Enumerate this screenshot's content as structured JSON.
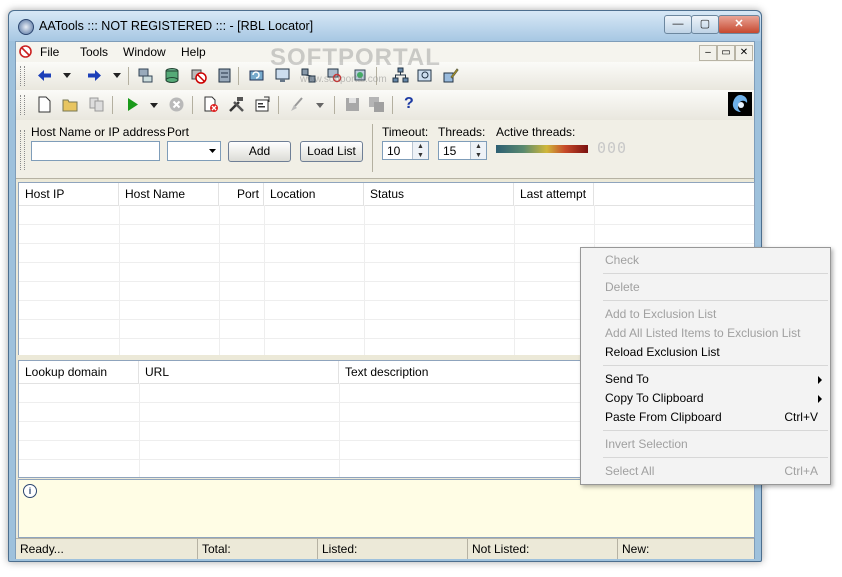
{
  "window": {
    "title": "AATools ::: NOT REGISTERED ::: - [RBL Locator]",
    "minimize": "0",
    "maximize": "1",
    "close": "r"
  },
  "menubar": {
    "items": [
      "File",
      "Tools",
      "Window",
      "Help"
    ],
    "mdi_minimize": "–",
    "mdi_restore": "▭",
    "mdi_close": "✕"
  },
  "toolbar1": {
    "icons": [
      "back-arrow-icon",
      "dropdown-arrow-icon",
      "forward-arrow-icon",
      "dropdown-arrow-icon",
      "network-computer-icon",
      "database-icon",
      "block-icon",
      "server-icon",
      "refresh-network-icon",
      "monitor-icon",
      "network-tools-icon",
      "lookup-icon",
      "hierarchy-icon",
      "map-icon",
      "pencil-icon"
    ]
  },
  "toolbar2": {
    "icons": [
      "new-file-icon",
      "open-folder-icon",
      "copy-icon",
      "play-icon",
      "dropdown-arrow-icon",
      "stop-icon",
      "delete-file-icon",
      "tools-icon",
      "properties-icon",
      "brush-icon",
      "dropdown-arrow-icon",
      "save-icon",
      "save-all-icon",
      "help-icon"
    ],
    "help_glyph": "?"
  },
  "form": {
    "host_label": "Host Name or IP address",
    "host_value": "",
    "port_label": "Port",
    "port_value": "",
    "add_label": "Add",
    "load_list_label": "Load List",
    "timeout_label": "Timeout:",
    "timeout_value": "10",
    "threads_label": "Threads:",
    "threads_value": "15",
    "active_threads_label": "Active threads:",
    "active_threads_value": "000"
  },
  "hosts_table": {
    "columns": [
      "Host IP",
      "Host Name",
      "Port",
      "Location",
      "Status",
      "Last attempt"
    ]
  },
  "lookup_table": {
    "columns": [
      "Lookup domain",
      "URL",
      "Text description"
    ]
  },
  "log": {
    "icon": "info-icon",
    "glyph": "i"
  },
  "statusbar": {
    "cells": [
      "Ready...",
      "Total:",
      "Listed:",
      "Not Listed:",
      "New:"
    ]
  },
  "context_menu": {
    "check": "Check",
    "delete": "Delete",
    "add_to_exclusion": "Add to Exclusion List",
    "add_all_to_exclusion": "Add All Listed Items to Exclusion List",
    "reload_exclusion": "Reload Exclusion List",
    "send_to": "Send To",
    "copy_to_clipboard": "Copy To Clipboard",
    "paste_from_clipboard": "Paste From Clipboard",
    "paste_shortcut": "Ctrl+V",
    "invert_selection": "Invert Selection",
    "select_all": "Select All",
    "select_all_shortcut": "Ctrl+A"
  },
  "watermark": {
    "text": "SOFTPORTAL",
    "sub": "www.softportal.com"
  }
}
